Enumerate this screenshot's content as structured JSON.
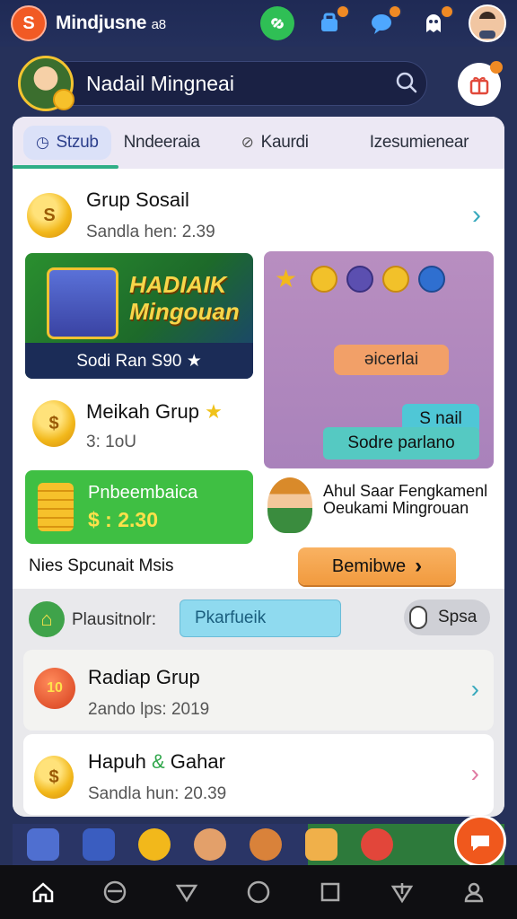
{
  "app": {
    "title": "Mindjusne ",
    "title_suffix": "a8",
    "logo": "S"
  },
  "top_icons": [
    "link-icon",
    "shopping-icon",
    "chat-icon",
    "game-icon"
  ],
  "profile": {
    "name": "Nadail Mingneai",
    "search_icon": "search-icon",
    "gift_icon": "gift-icon"
  },
  "tabs": [
    {
      "label": "Stzub",
      "icon": "clock-icon",
      "active": true
    },
    {
      "label": "Nndeeraia",
      "active": false
    },
    {
      "label": "Kaurdi",
      "icon": "check-circle-icon",
      "active": false
    },
    {
      "label": "Izesumienear",
      "active": false
    }
  ],
  "group_social": {
    "title": "Grup Sosail",
    "subtitle": "Sandla hen: 2.39",
    "coin": "S"
  },
  "banner_green": {
    "headline": "HADIAIK Mingouan",
    "footer": "Sodi Ran S90 ★"
  },
  "banner_purple": {
    "bubble_orange": "ǝicerlai",
    "bubble_teal_small": "S nail",
    "bubble_teal": "Sodre parlano"
  },
  "melikah": {
    "title": "Meikah Grup",
    "star": "★",
    "subtitle": "3: 1oU",
    "coin": "$"
  },
  "reward": {
    "title": "Pnbeembaica",
    "value": "$ : 2.30"
  },
  "character_text": {
    "line1": "Ahul Saar Fengkamenl",
    "line2": "Oeukami Mingrouan"
  },
  "nies_text": "Nies Spcunait Msis",
  "orange_button": {
    "label": "Bemibwe",
    "arrow": "›"
  },
  "filter": {
    "label": "Plausitnolr:",
    "input_value": "Pkarfueik",
    "toggle_label": "Spsa"
  },
  "list": [
    {
      "title": "Radiap Grup",
      "subtitle": "2ando lps: 2019",
      "badge": "10"
    },
    {
      "title_a": "Hapuh",
      "amp": "&",
      "title_b": "Gahar",
      "subtitle": "Sandla hun: 20.39",
      "coin": "$"
    }
  ],
  "bottom_nav": [
    "home-icon",
    "circle-minus-icon",
    "triangle-down-icon",
    "circle-icon",
    "square-icon",
    "download-icon",
    "user-icon"
  ]
}
